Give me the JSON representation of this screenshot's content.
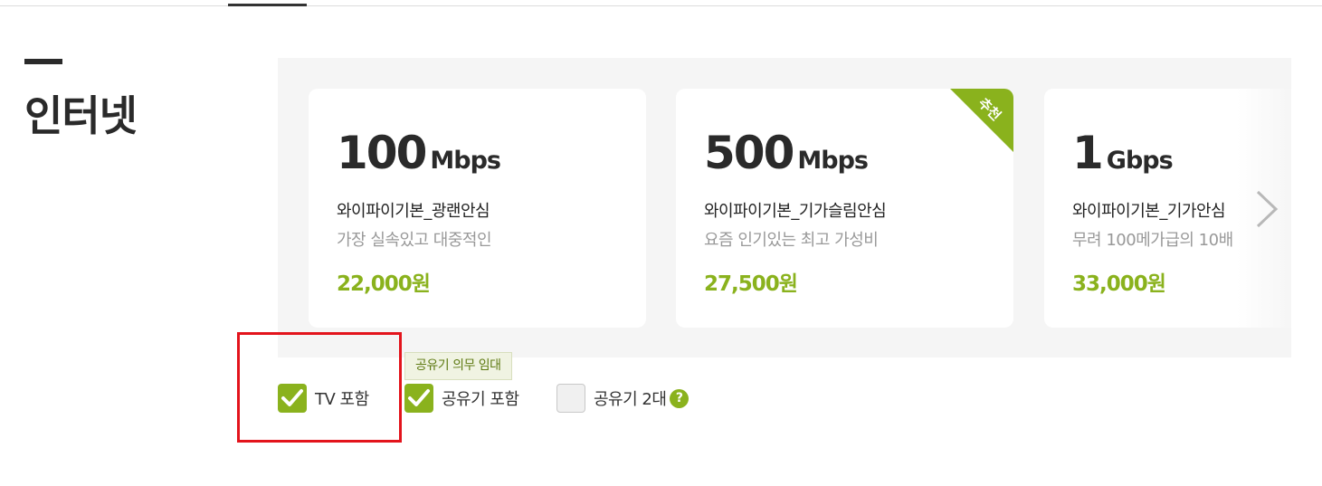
{
  "section": {
    "title": "인터넷"
  },
  "plans": [
    {
      "speed": "100",
      "unit": "Mbps",
      "name": "와이파이기본_광랜안심",
      "desc": "가장 실속있고 대중적인",
      "price": "22,000원"
    },
    {
      "speed": "500",
      "unit": "Mbps",
      "name": "와이파이기본_기가슬림안심",
      "desc": "요즘 인기있는 최고 가성비",
      "price": "27,500원",
      "badge": "추천"
    },
    {
      "speed": "1",
      "unit": "Gbps",
      "name": "와이파이기본_기가안심",
      "desc": "무려 100메가급의 10배",
      "price": "33,000원"
    }
  ],
  "tooltip": "공유기 의무 임대",
  "options": [
    {
      "label": "TV 포함",
      "checked": true
    },
    {
      "label": "공유기 포함",
      "checked": true
    },
    {
      "label": "공유기 2대",
      "checked": false,
      "help": "?"
    }
  ],
  "colors": {
    "accent": "#8ab21d",
    "highlight": "#e3141c"
  },
  "icons": {
    "check": "check-icon",
    "next": "chevron-right-icon",
    "help": "help-circle-icon"
  }
}
